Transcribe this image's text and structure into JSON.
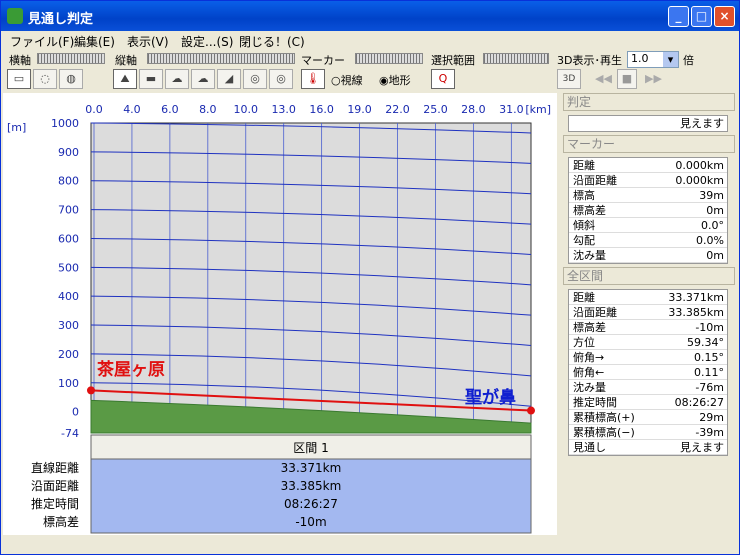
{
  "window": {
    "title": "見通し判定",
    "min": "_",
    "max": "□",
    "close": "×"
  },
  "menu": [
    "ファイル(F)",
    "編集(E)",
    "表示(V)",
    "設定...(S)",
    "閉じる！(C)"
  ],
  "toolbar": {
    "h_axis": "横軸",
    "v_axis": "縦軸",
    "marker": "マーカー",
    "range": "選択範囲",
    "play3d": "3D表示･再生",
    "scale_value": "1.0",
    "scale_unit": "倍",
    "radio_sight": "視線",
    "radio_terrain": "地形",
    "btn3d": "3D"
  },
  "chart_data": {
    "type": "area",
    "x_unit": "[km]",
    "y_unit": "[m]",
    "x_ticks": [
      "0.0",
      "4.0",
      "6.0",
      "8.0",
      "10.0",
      "13.0",
      "16.0",
      "19.0",
      "22.0",
      "25.0",
      "28.0",
      "31.0"
    ],
    "y_ticks": [
      "1000",
      "900",
      "800",
      "700",
      "600",
      "500",
      "400",
      "300",
      "200",
      "100",
      "0",
      "-74"
    ],
    "ylim": [
      -74,
      1000
    ],
    "start_label": "茶屋ヶ原",
    "end_label": "聖が鼻",
    "sight_line": {
      "start_elev": 39,
      "end_elev": -10
    },
    "terrain": {
      "start_elev": 39,
      "end_elev": -40
    }
  },
  "section": {
    "header": "区間 1",
    "labels": [
      "直線距離",
      "沿面距離",
      "推定時間",
      "標高差"
    ],
    "values": [
      "33.371km",
      "33.385km",
      "08:26:27",
      "-10m"
    ]
  },
  "judge": {
    "title": "判定",
    "value": "見えます"
  },
  "marker_panel": {
    "title": "マーカー",
    "rows": [
      [
        "距離",
        "0.000km"
      ],
      [
        "沿面距離",
        "0.000km"
      ],
      [
        "標高",
        "39m"
      ],
      [
        "標高差",
        "0m"
      ],
      [
        "傾斜",
        "0.0°"
      ],
      [
        "勾配",
        "0.0%"
      ],
      [
        "沈み量",
        "0m"
      ]
    ]
  },
  "all_panel": {
    "title": "全区間",
    "rows": [
      [
        "距離",
        "33.371km"
      ],
      [
        "沿面距離",
        "33.385km"
      ],
      [
        "標高差",
        "-10m"
      ],
      [
        "方位",
        "59.34°"
      ],
      [
        "俯角→",
        "0.15°"
      ],
      [
        "俯角←",
        "0.11°"
      ],
      [
        "沈み量",
        "-76m"
      ],
      [
        "推定時間",
        "08:26:27"
      ],
      [
        "累積標高(+)",
        "29m"
      ],
      [
        "累積標高(−)",
        "-39m"
      ],
      [
        "見通し",
        "見えます"
      ]
    ]
  }
}
